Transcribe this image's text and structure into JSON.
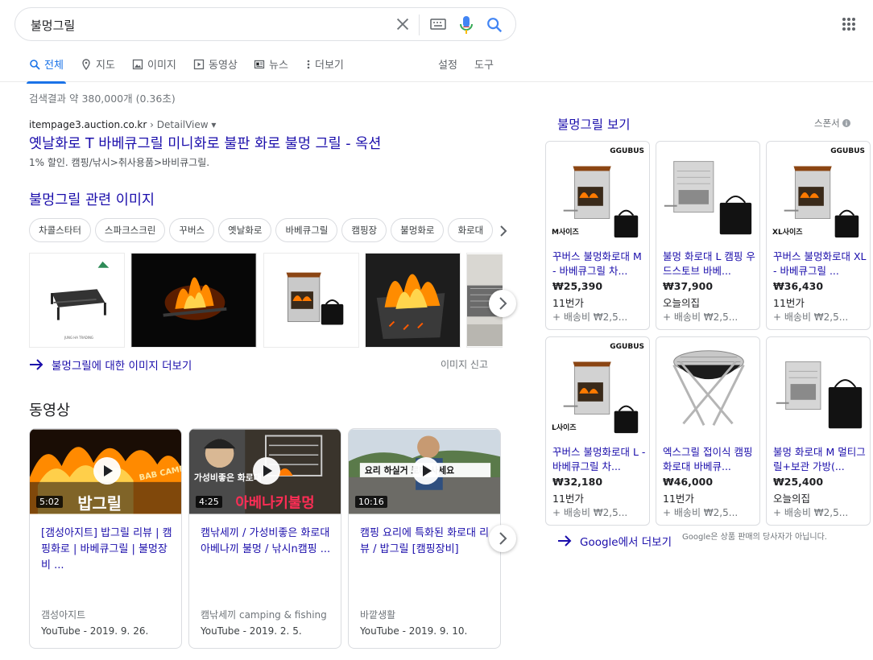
{
  "search": {
    "query": "불멍그릴"
  },
  "tabs": [
    {
      "label": "전체",
      "icon": "search-icon"
    },
    {
      "label": "지도",
      "icon": "map-pin-icon"
    },
    {
      "label": "이미지",
      "icon": "image-icon"
    },
    {
      "label": "동영상",
      "icon": "video-icon"
    },
    {
      "label": "뉴스",
      "icon": "news-icon"
    },
    {
      "label": "더보기",
      "icon": "more-vert-icon"
    },
    {
      "label": "설정"
    },
    {
      "label": "도구"
    }
  ],
  "stats": "검색결과 약 380,000개 (0.36초)",
  "result": {
    "domain": "itempage3.auction.co.kr",
    "crumb": " › DetailView ▾",
    "title": "옛날화로 T 바베큐그릴 미니화로 불판 화로 불멍 그릴 - 옥션",
    "snippet": "1% 할인. 캠핑/낚시>취사용품>바비큐그릴."
  },
  "images": {
    "heading": "불멍그릴 관련 이미지",
    "chips": [
      "차콜스타터",
      "스파크스크린",
      "꾸버스",
      "옛날화로",
      "바베큐그릴",
      "캠핑장",
      "불멍화로",
      "화로대"
    ],
    "more": "불멍그릴에 대한 이미지 더보기",
    "report": "이미지 신고"
  },
  "videos": {
    "heading": "동영상",
    "items": [
      {
        "duration": "5:02",
        "title": "[갬성아지트] 밥그릴 리뷰 | 캠핑화로 | 바베큐그릴 | 불멍장비 ...",
        "channel": "갬성아지트",
        "source": "YouTube - 2019. 9. 26.",
        "overlay": "밥그릴",
        "overlay2": "BAB CAMPING"
      },
      {
        "duration": "4:25",
        "title": "캠낚세끼 / 가성비좋은 화로대 아베나끼 불멍 / 낚시n캠핑 ...",
        "channel": "캠낚세끼 camping & fishing",
        "source": "YouTube - 2019. 2. 5.",
        "overlay": "아베나키불멍",
        "overlay2": "가성비좋은 화로대"
      },
      {
        "duration": "10:16",
        "title": "캠핑 요리에 특화된 화로대 리뷰 / 밥그릴 [캠핑장비]",
        "channel": "바깥생활",
        "source": "YouTube - 2019. 9. 10.",
        "overlay": "요리 하실거    로대 사세요"
      }
    ]
  },
  "shopping": {
    "title": "불멍그릴 보기",
    "sponsor": "스폰서",
    "products": [
      {
        "name": "꾸버스 불멍화로대 M - 바베큐그릴 차...",
        "price": "₩25,390",
        "store": "11번가",
        "shipping": "+ 배송비 ₩2,5...",
        "brand": "GGUBUS",
        "size": "M사이즈"
      },
      {
        "name": "불멍 화로대 L 캠핑 우드스토브 바베...",
        "price": "₩37,900",
        "store": "오늘의집",
        "shipping": "+ 배송비 ₩2,5...",
        "brand": "",
        "size": ""
      },
      {
        "name": "꾸버스 불멍화로대 XL - 바베큐그릴 ...",
        "price": "₩36,430",
        "store": "11번가",
        "shipping": "+ 배송비 ₩2,5...",
        "brand": "GGUBUS",
        "size": "XL사이즈"
      },
      {
        "name": "꾸버스 불멍화로대 L - 바베큐그릴 차...",
        "price": "₩32,180",
        "store": "11번가",
        "shipping": "+ 배송비 ₩2,5...",
        "brand": "GGUBUS",
        "size": "L사이즈"
      },
      {
        "name": "엑스그릴 접이식 캠핑화로대 바베큐...",
        "price": "₩46,000",
        "store": "11번가",
        "shipping": "+ 배송비 ₩2,5...",
        "brand": "",
        "size": ""
      },
      {
        "name": "불멍 화로대 M 멀티그릴+보관 가방(...",
        "price": "₩25,400",
        "store": "오늘의집",
        "shipping": "+ 배송비 ₩2,5...",
        "brand": "",
        "size": ""
      }
    ],
    "more": "Google에서 더보기",
    "note": "Google은 상품 판매의 당사자가 아닙니다."
  },
  "colors": {
    "link": "#1a0dab",
    "accent": "#1a73e8",
    "muted": "#70757a"
  }
}
